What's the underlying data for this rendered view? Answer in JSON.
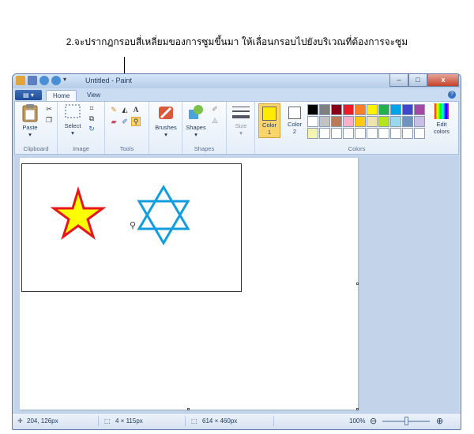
{
  "caption": "2.จะปรากฎกรอบสี่เหลี่ยมของการซูมขึ้นมา ให้เลื่อนกรอบไปยังบริเวณที่ต้องการจะซูม",
  "window": {
    "title": "Untitled - Paint",
    "min": "–",
    "max": "□",
    "close": "x"
  },
  "tabs": {
    "menu": "▤ ▾",
    "home": "Home",
    "view": "View",
    "help": "?"
  },
  "ribbon": {
    "clipboard": {
      "label": "Clipboard",
      "paste": "Paste"
    },
    "image": {
      "label": "Image",
      "select": "Select"
    },
    "tools": {
      "label": "Tools"
    },
    "brushes": {
      "label": "Brushes"
    },
    "shapes": {
      "label": "Shapes",
      "button": "Shapes"
    },
    "size": {
      "label": "Size"
    },
    "color1": {
      "label": "Color",
      "num": "1",
      "value": "#ffeb00"
    },
    "color2": {
      "label": "Color",
      "num": "2",
      "value": "#ffffff"
    },
    "colors_group": "Colors",
    "edit_colors": {
      "line1": "Edit",
      "line2": "colors"
    }
  },
  "palette": [
    "#000000",
    "#7f7f7f",
    "#880015",
    "#ed1c24",
    "#ff7f27",
    "#fff200",
    "#22b14c",
    "#00a2e8",
    "#3f48cc",
    "#a349a4",
    "#ffffff",
    "#c3c3c3",
    "#b97a57",
    "#ffaec9",
    "#ffc90e",
    "#efe4b0",
    "#b5e61d",
    "#99d9ea",
    "#7092be",
    "#c8bfe7",
    "#f5f3b0",
    "#ffffff",
    "#ffffff",
    "#ffffff",
    "#ffffff",
    "#ffffff",
    "#ffffff",
    "#ffffff",
    "#ffffff",
    "#ffffff"
  ],
  "status": {
    "cursor_pos": "204, 126px",
    "selection_size": "4 × 115px",
    "canvas_size": "614 × 460px",
    "zoom": "100%",
    "zoom_level": 0.5
  },
  "shapes_colors": {
    "star_fill": "#ffff00",
    "star_stroke": "#e8161c",
    "hexstar_stroke": "#119de0"
  }
}
